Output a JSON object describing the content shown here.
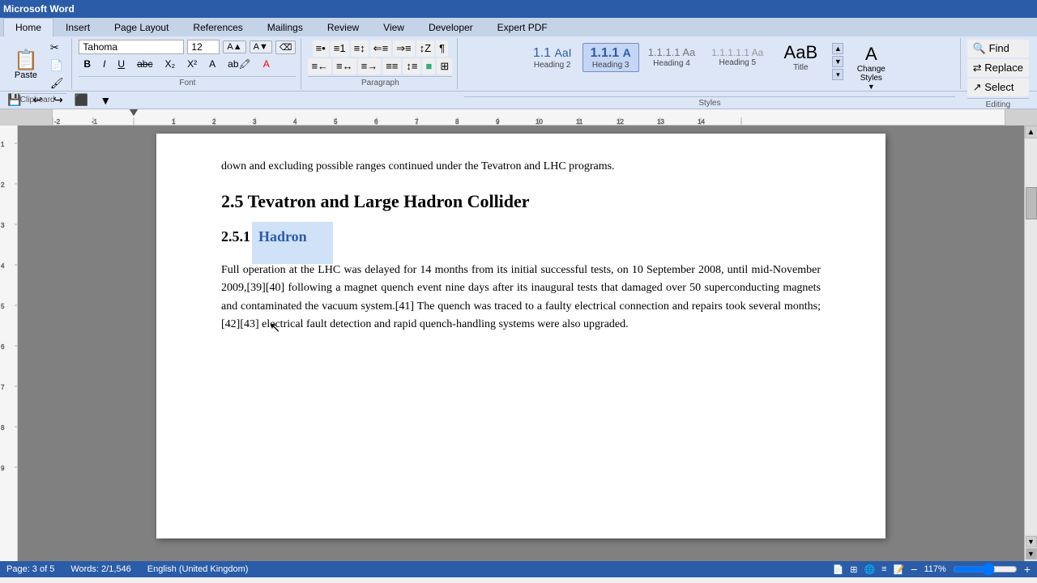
{
  "titlebar": {
    "title": "Microsoft Word"
  },
  "tabs": {
    "items": [
      "Home",
      "Insert",
      "Page Layout",
      "References",
      "Mailings",
      "Review",
      "View",
      "Developer",
      "Expert PDF"
    ],
    "active": "Home"
  },
  "quickaccess": {
    "buttons": [
      "💾",
      "↩",
      "↪",
      "⬛",
      "📋"
    ]
  },
  "font": {
    "name": "Tahoma",
    "size": "12",
    "placeholder_font": "Tahoma",
    "placeholder_size": "12"
  },
  "styles": {
    "items": [
      {
        "id": "h2",
        "preview": "1.1",
        "full_preview": "AaI",
        "label": "Heading 2",
        "active": false
      },
      {
        "id": "h3",
        "preview": "1.1.1",
        "full_preview": "A",
        "label": "Heading 3",
        "active": true
      },
      {
        "id": "h4",
        "preview": "1.1.1.1",
        "full_preview": "Aa",
        "label": "Heading 4",
        "active": false
      },
      {
        "id": "h5",
        "preview": "1.1.1.1.1",
        "full_preview": "Aa",
        "label": "Heading 5",
        "active": false
      },
      {
        "id": "title",
        "preview": "AaB",
        "label": "Title",
        "active": false
      }
    ],
    "change_label": "Change\nStyles"
  },
  "editing": {
    "find_label": "Find",
    "replace_label": "Replace",
    "select_label": "Select"
  },
  "document": {
    "intro_text": "down and excluding possible ranges continued under the Tevatron and LHC programs.",
    "heading_25": "2.5   Tevatron and Large Hadron Collider",
    "heading_251_num": "2.5.1",
    "heading_251_text": "Hadron",
    "body_text": "Full operation at the LHC was delayed for 14 months from its initial successful tests, on 10 September 2008, until mid-November 2009,[39][40] following a magnet quench event nine days after its inaugural tests that damaged over 50 superconducting magnets and contaminated the vacuum system.[41] The quench was traced to a faulty electrical connection and repairs took several months;[42][43] electrical fault detection and rapid quench-handling systems were also upgraded."
  },
  "statusbar": {
    "page_info": "Page: 3 of 5",
    "words_info": "Words: 2/1,546",
    "language": "English (United Kingdom)",
    "zoom": "117%"
  }
}
